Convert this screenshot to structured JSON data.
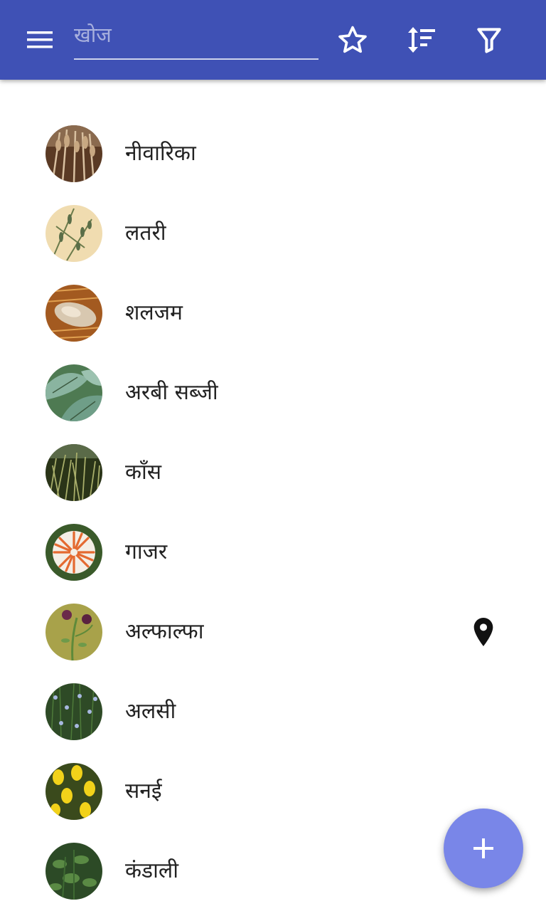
{
  "toolbar": {
    "search_placeholder": "खोज",
    "search_value": "",
    "colors": {
      "bar": "#3f51b5",
      "fab": "#7986e8"
    },
    "icons": [
      "menu-icon",
      "star-outline-icon",
      "sort-icon",
      "filter-icon"
    ]
  },
  "items": [
    {
      "label": "नीवारिका",
      "thumb": "oat-photo"
    },
    {
      "label": "लतरी",
      "thumb": "vetch-botanical-illustration"
    },
    {
      "label": "शलजम",
      "thumb": "turnip-photo"
    },
    {
      "label": "अरबी सब्जी",
      "thumb": "taro-leaves-photo"
    },
    {
      "label": "काँस",
      "thumb": "kans-grass-photo"
    },
    {
      "label": "गाजर",
      "thumb": "carrots-photo"
    },
    {
      "label": "अल्फाल्फा",
      "thumb": "alfalfa-flower-photo",
      "location_icon": "map-marker-icon"
    },
    {
      "label": "अलसी",
      "thumb": "flax-field-photo"
    },
    {
      "label": "सनई",
      "thumb": "sunn-hemp-flower-photo"
    },
    {
      "label": "कंडाली",
      "thumb": "nettle-plant-photo"
    }
  ],
  "fab": {
    "icon": "plus-icon"
  }
}
